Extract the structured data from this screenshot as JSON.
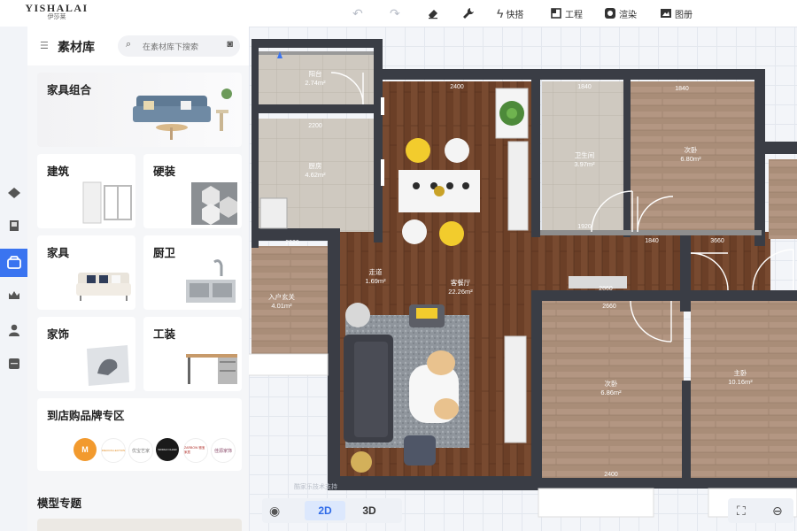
{
  "logo": {
    "brand": "YISHALAI",
    "sub": "伊莎莱"
  },
  "toolbar": {
    "undo_icon": "undo-icon",
    "redo_icon": "redo-icon",
    "eraser_icon": "eraser-icon",
    "wrench_icon": "wrench-icon",
    "quick_label": "快搭",
    "engineering_label": "工程",
    "render_label": "渲染",
    "drawings_label": "图册"
  },
  "panel": {
    "title": "素材库",
    "search_placeholder": "在素材库下搜索",
    "cards": {
      "furniture_set": "家具组合",
      "building": "建筑",
      "hardware": "硬装",
      "furniture": "家具",
      "kitchen_bath": "厨卫",
      "decor": "家饰",
      "tooling": "工装",
      "brand_zone": "到店购品牌专区"
    },
    "brands": [
      "M",
      "DIEUCOLLECTION",
      "优宝艺家",
      "WORLD CHAIR",
      "ZARBOW 雅宝家居",
      "佳源家饰"
    ],
    "model_topics": "模型专题"
  },
  "rail": [
    "home-shape-icon",
    "building-icon",
    "cube-box-icon",
    "crown-icon",
    "user-icon",
    "storage-icon"
  ],
  "plan": {
    "rooms": [
      {
        "name": "阳台",
        "area": "2.74m²"
      },
      {
        "name": "厨房",
        "area": "4.62m²"
      },
      {
        "name": "卫生间",
        "area": "3.97m²"
      },
      {
        "name": "次卧",
        "area": "6.80m²"
      },
      {
        "name": "走道",
        "area": "1.69m²"
      },
      {
        "name": "客餐厅",
        "area": "22.26m²"
      },
      {
        "name": "入户玄关",
        "area": "4.01m²"
      },
      {
        "name": "次卧",
        "area": "6.86m²"
      },
      {
        "name": "主卧",
        "area": "10.16m²"
      }
    ],
    "dims": [
      "2400",
      "2200",
      "1920",
      "1840",
      "2860",
      "2400",
      "1840",
      "2660",
      "1840",
      "3660",
      "2220"
    ],
    "watermark": "酷家乐技术支持"
  },
  "view": {
    "label_2d": "2D",
    "label_3d": "3D"
  },
  "colors": {
    "accent": "#3a74f0",
    "wall": "#3a3d45",
    "wood_dark": "#6b3f27",
    "wood_light": "#a98d78",
    "tile": "#cfc9c0"
  }
}
